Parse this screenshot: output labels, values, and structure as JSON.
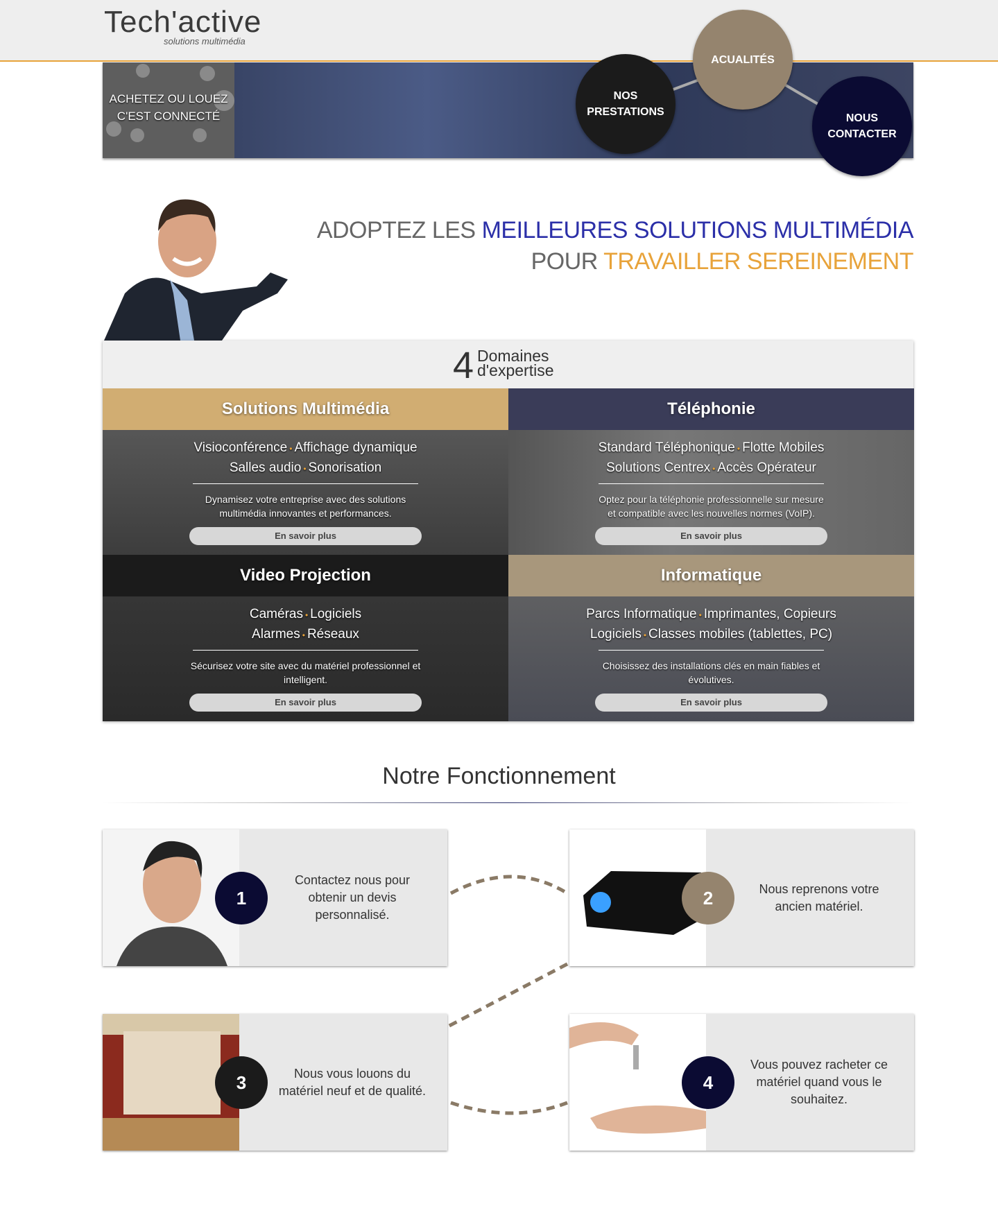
{
  "header": {
    "logo_main": "Tech'active",
    "logo_sub": "solutions multimédia"
  },
  "banner": {
    "tagline_1": "ACHETEZ OU LOUEZ",
    "tagline_2": "C'EST CONNECTÉ"
  },
  "nav": {
    "prestations_1": "NOS",
    "prestations_2": "PRESTATIONS",
    "actualites": "ACUALITÉS",
    "contact_1": "NOUS",
    "contact_2": "CONTACTER"
  },
  "colors": {
    "accent_orange": "#e8a33a",
    "brand_blue": "#2b2fa8",
    "taupe": "#95846e",
    "navy": "#0b0b33",
    "dark": "#1b1b1b"
  },
  "headline": {
    "l1_a": "ADOPTEZ LES ",
    "l1_b": "MEILLEURES SOLUTIONS MULTIMÉDIA",
    "l2_a": "POUR ",
    "l2_b": "TRAVAILLER SEREINEMENT"
  },
  "domains": {
    "number": "4",
    "label_1": "Domaines",
    "label_2": "d'expertise",
    "tiles": [
      {
        "title": "Solutions Multimédia",
        "items": [
          [
            "Visioconférence",
            "Affichage dynamique"
          ],
          [
            "Salles audio",
            "Sonorisation"
          ]
        ],
        "desc": "Dynamisez votre entreprise avec des solutions multimédia innovantes et performances.",
        "button": "En savoir plus"
      },
      {
        "title": "Téléphonie",
        "items": [
          [
            "Standard Téléphonique",
            "Flotte Mobiles"
          ],
          [
            "Solutions Centrex",
            "Accès Opérateur"
          ]
        ],
        "desc": "Optez pour la téléphonie professionnelle sur mesure et compatible avec les nouvelles normes (VoIP).",
        "button": "En savoir plus"
      },
      {
        "title": "Video Projection",
        "items": [
          [
            "Caméras",
            "Logiciels"
          ],
          [
            "Alarmes",
            "Réseaux"
          ]
        ],
        "desc": "Sécurisez votre site avec du matériel professionnel et intelligent.",
        "button": "En savoir plus"
      },
      {
        "title": "Informatique",
        "items": [
          [
            "Parcs Informatique",
            "Imprimantes, Copieurs"
          ],
          [
            "Logiciels",
            "Classes mobiles (tablettes, PC)"
          ]
        ],
        "desc": "Choisissez des installations clés en main fiables et évolutives.",
        "button": "En savoir plus"
      }
    ]
  },
  "fonctionnement": {
    "title": "Notre Fonctionnement",
    "steps": [
      {
        "num": "1",
        "text": "Contactez nous pour obtenir un devis personnalisé."
      },
      {
        "num": "2",
        "text": "Nous reprenons votre ancien matériel."
      },
      {
        "num": "3",
        "text": "Nous vous louons du matériel neuf et de qualité."
      },
      {
        "num": "4",
        "text": "Vous pouvez racheter ce matériel quand vous le souhaitez."
      }
    ]
  }
}
